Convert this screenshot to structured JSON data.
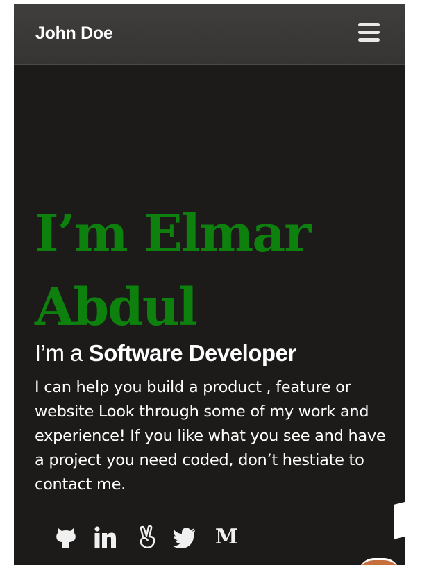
{
  "navbar": {
    "brand": "John Doe",
    "menu_icon": "hamburger-menu-icon"
  },
  "hero": {
    "name_line1": "I’m Elmar",
    "name_line2": "Abdul",
    "role_prefix": "I’m a ",
    "role": "Software Developer",
    "description": "I can help you build a product , feature or website Look through some of my work and experience! If you like what you see and have a project you need coded, don’t hestiate to contact me."
  },
  "socials": [
    {
      "icon": "github-icon"
    },
    {
      "icon": "linkedin-icon"
    },
    {
      "icon": "angellist-icon"
    },
    {
      "icon": "twitter-icon"
    },
    {
      "icon": "medium-icon",
      "glyph": "M"
    }
  ],
  "colors": {
    "background": "#1c1b1a",
    "navbar": "#3a3938",
    "accent": "#0d800d",
    "text": "#ffffff"
  }
}
